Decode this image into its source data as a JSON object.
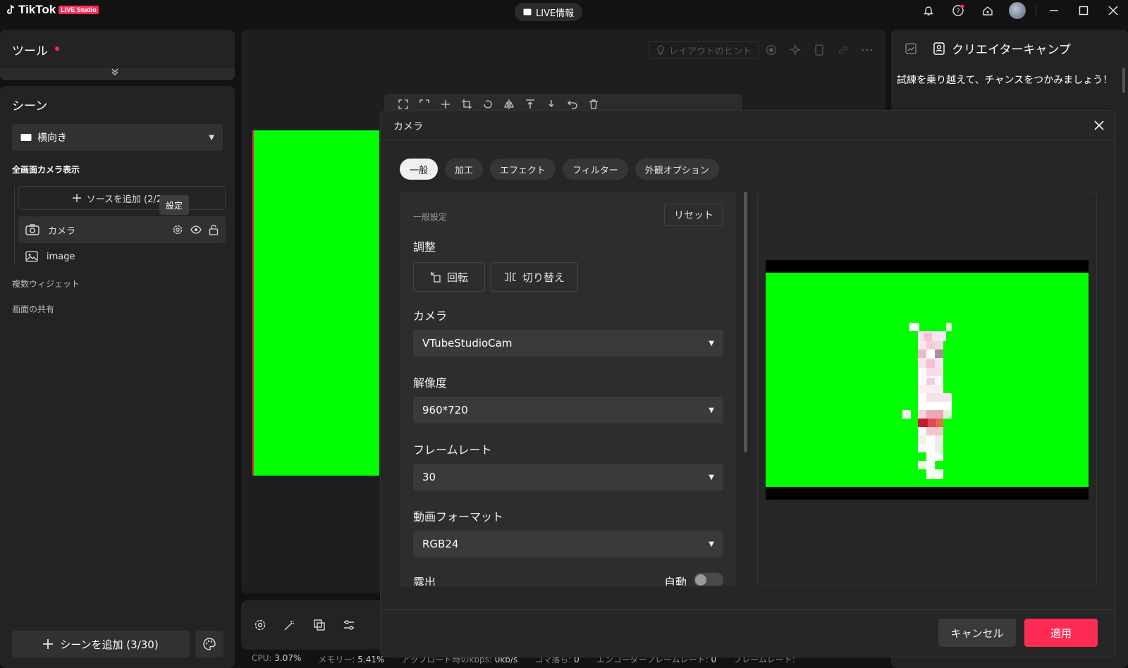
{
  "topbar": {
    "brand": "TikTok",
    "brand_badge": "LIVE Studio",
    "live_info": "LIVE情報"
  },
  "left": {
    "tools_title": "ツール",
    "scene_title": "シーン",
    "scene_select": "横向き",
    "scene_group": "全画面カメラ表示",
    "add_source": "ソースを追加 (2/20)",
    "tooltip": "設定",
    "sources": [
      {
        "name": "カメラ"
      },
      {
        "name": "image"
      }
    ],
    "multi_widget": "複数ウィジェット",
    "screen_share": "画面の共有",
    "add_scene": "シーンを追加 (3/30)"
  },
  "stage": {
    "layout_hint": "レイアウトのヒント"
  },
  "statusbar": {
    "cpu_label": "CPU:",
    "cpu_value": "3.07%",
    "mem_label": "メモリー:",
    "mem_value": "5.41%",
    "upload_label": "アップロード時のkbps:",
    "upload_value": "0kb/s",
    "drop_label": "コマ落ち:",
    "drop_value": "0",
    "encoder_label": "エンコーダーフレームレート:",
    "encoder_value": "0",
    "framerate_label": "フレームレート:"
  },
  "right": {
    "title": "クリエイターキャンプ",
    "text": "試練を乗り越えて、チャンスをつかみましょう！"
  },
  "modal": {
    "title": "カメラ",
    "tabs": [
      {
        "label": "一般",
        "active": true
      },
      {
        "label": "加工",
        "active": false
      },
      {
        "label": "エフェクト",
        "active": false
      },
      {
        "label": "フィルター",
        "active": false
      },
      {
        "label": "外観オプション",
        "active": false
      }
    ],
    "general_settings": "一般設定",
    "reset": "リセット",
    "adjust_label": "調整",
    "rotate": "回転",
    "flip": "切り替え",
    "camera_label": "カメラ",
    "camera_value": "VTubeStudioCam",
    "resolution_label": "解像度",
    "resolution_value": "960*720",
    "framerate_label": "フレームレート",
    "framerate_value": "30",
    "format_label": "動画フォーマット",
    "format_value": "RGB24",
    "exposure_label": "露出",
    "exposure_auto": "自動",
    "cancel": "キャンセル",
    "apply": "適用"
  },
  "colors": {
    "accent": "#fe2c55",
    "chroma": "#00ff00",
    "panel": "#232323"
  }
}
